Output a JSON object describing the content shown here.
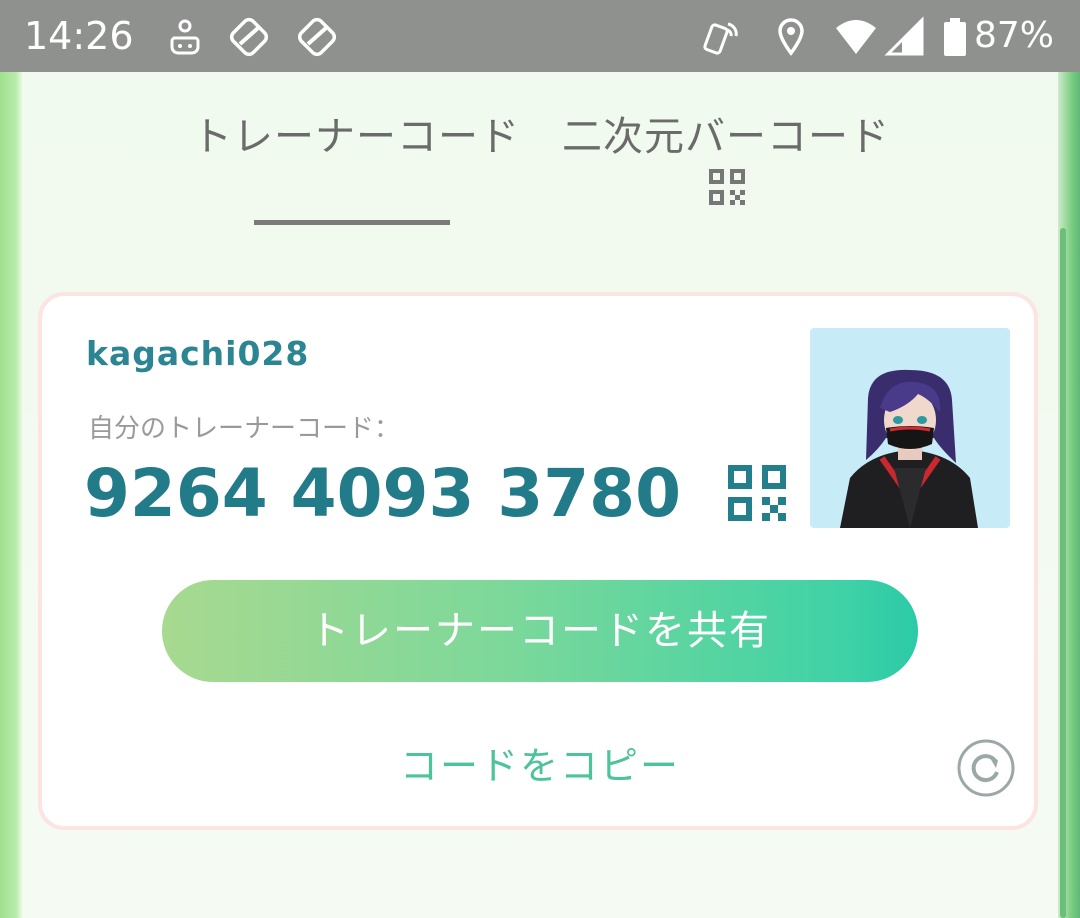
{
  "status_bar": {
    "time": "14:26",
    "battery_percent": "87%",
    "icons": [
      "notification-icon",
      "app-icon",
      "app-icon",
      "nfc-icon",
      "location-icon",
      "wifi-icon",
      "signal-icon",
      "battery-icon"
    ]
  },
  "tabs": [
    {
      "label": "トレーナーコード",
      "active": true
    },
    {
      "label": "二次元バーコード",
      "active": false,
      "icon": "qr-code-icon"
    }
  ],
  "card": {
    "username": "kagachi028",
    "code_label": "自分のトレーナーコード：",
    "trainer_code": "9264 4093 3780",
    "share_button_label": "トレーナーコードを共有",
    "copy_link_label": "コードをコピー"
  },
  "colors": {
    "accent_teal": "#217b88",
    "username_teal": "#2b8592",
    "copy_green": "#4cc39a",
    "status_bar_gray": "#8e918e",
    "avatar_bg": "#c7ecf8"
  }
}
